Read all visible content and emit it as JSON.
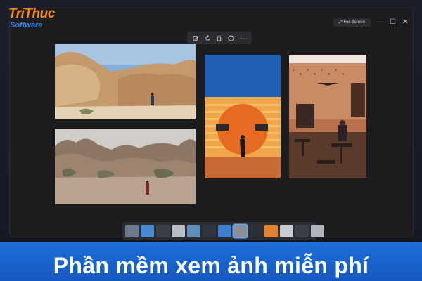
{
  "logo": {
    "line1": "TriThuc",
    "line2": "Software"
  },
  "window": {
    "fullscreen_label": "Full Screen",
    "minimize_glyph": "—",
    "maximize_glyph": "☐",
    "close_glyph": "✕"
  },
  "toolbar": {
    "icons": [
      "edit-icon",
      "rotate-icon",
      "delete-icon",
      "info-icon",
      "more-icon"
    ],
    "more_glyph": "···"
  },
  "photos": [
    {
      "name": "desert-rock-hiker",
      "colors": [
        "#7fa9d6",
        "#c89a6c",
        "#b88858"
      ]
    },
    {
      "name": "desert-boulders-hiker",
      "colors": [
        "#c9c5bf",
        "#8f7865",
        "#6f5a49"
      ]
    },
    {
      "name": "orange-sun-mural",
      "colors": [
        "#1e5bb0",
        "#e8782b",
        "#f0b043"
      ]
    },
    {
      "name": "cafe-interior",
      "colors": [
        "#c77a55",
        "#7a3a2a",
        "#3c2a22"
      ]
    }
  ],
  "thumbnails": {
    "count": 14,
    "selected_index": 7
  },
  "banner": {
    "title": "Phần mềm xem ảnh miễn phí"
  }
}
